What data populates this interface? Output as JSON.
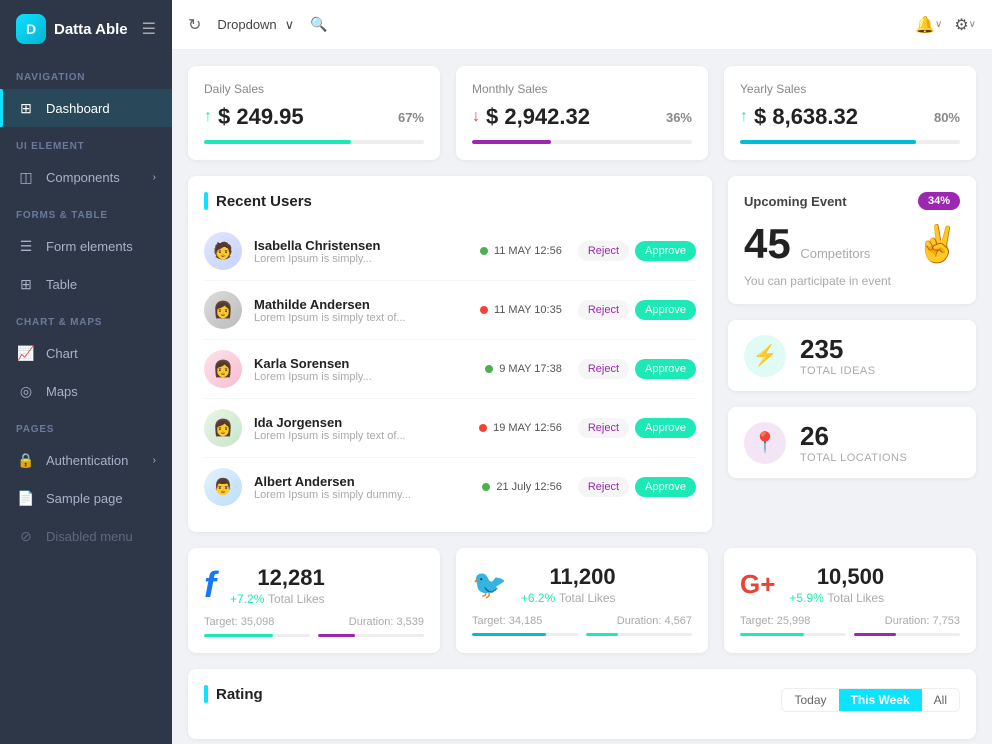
{
  "app": {
    "name": "Datta Able",
    "logo_letter": "D"
  },
  "header": {
    "dropdown_label": "Dropdown",
    "bell_label": "notifications",
    "gear_label": "settings"
  },
  "sidebar": {
    "nav_label": "NAVIGATION",
    "ui_label": "UI ELEMENT",
    "forms_label": "FORMS & TABLE",
    "charts_label": "CHART & MAPS",
    "pages_label": "PAGES",
    "items": [
      {
        "id": "dashboard",
        "label": "Dashboard",
        "icon": "⊞",
        "active": true
      },
      {
        "id": "components",
        "label": "Components",
        "icon": "◫",
        "has_chevron": true
      },
      {
        "id": "form-elements",
        "label": "Form elements",
        "icon": "☰"
      },
      {
        "id": "table",
        "label": "Table",
        "icon": "⊞"
      },
      {
        "id": "chart",
        "label": "Chart",
        "icon": "📈"
      },
      {
        "id": "maps",
        "label": "Maps",
        "icon": "◎"
      },
      {
        "id": "authentication",
        "label": "Authentication",
        "icon": "🔒",
        "has_chevron": true
      },
      {
        "id": "sample-page",
        "label": "Sample page",
        "icon": "📄"
      },
      {
        "id": "disabled-menu",
        "label": "Disabled menu",
        "icon": "⊘",
        "disabled": true
      }
    ]
  },
  "stats": [
    {
      "id": "daily-sales",
      "title": "Daily Sales",
      "value": "$ 249.95",
      "arrow": "up",
      "percent": "67%",
      "bar_width": "67",
      "bar_color": "green"
    },
    {
      "id": "monthly-sales",
      "title": "Monthly Sales",
      "value": "$ 2,942.32",
      "arrow": "down",
      "percent": "36%",
      "bar_width": "36",
      "bar_color": "purple"
    },
    {
      "id": "yearly-sales",
      "title": "Yearly Sales",
      "value": "$ 8,638.32",
      "arrow": "up",
      "percent": "80%",
      "bar_width": "80",
      "bar_color": "teal"
    }
  ],
  "recent_users": {
    "title": "Recent Users",
    "users": [
      {
        "name": "Isabella Christensen",
        "desc": "Lorem Ipsum is simply...",
        "date": "11 MAY 12:56",
        "dot": "green",
        "avatar": "🧑"
      },
      {
        "name": "Mathilde Andersen",
        "desc": "Lorem Ipsum is simply text of...",
        "date": "11 MAY 10:35",
        "dot": "red",
        "avatar": "👩"
      },
      {
        "name": "Karla Sorensen",
        "desc": "Lorem Ipsum is simply...",
        "date": "9 MAY 17:38",
        "dot": "green",
        "avatar": "👩"
      },
      {
        "name": "Ida Jorgensen",
        "desc": "Lorem Ipsum is simply text of...",
        "date": "19 MAY 12:56",
        "dot": "red",
        "avatar": "👩"
      },
      {
        "name": "Albert Andersen",
        "desc": "Lorem Ipsum is simply dummy...",
        "date": "21 July 12:56",
        "dot": "green",
        "avatar": "👨"
      }
    ],
    "btn_reject": "Reject",
    "btn_approve": "Approve"
  },
  "upcoming_event": {
    "title": "Upcoming Event",
    "badge": "34%",
    "number": "45",
    "label": "Competitors",
    "desc": "You can participate in event"
  },
  "total_ideas": {
    "number": "235",
    "label": "TOTAL IDEAS"
  },
  "total_locations": {
    "number": "26",
    "label": "TOTAL LOCATIONS"
  },
  "social": [
    {
      "id": "facebook",
      "icon": "f",
      "type": "fb",
      "likes": "12,281",
      "growth": "+7.2%",
      "label": "Total Likes",
      "target_label": "Target:",
      "target_val": "35,098",
      "duration_label": "Duration:",
      "duration_val": "3,539",
      "bar1": 65,
      "bar2": 35
    },
    {
      "id": "twitter",
      "icon": "🐦",
      "type": "tw",
      "likes": "11,200",
      "growth": "+6.2%",
      "label": "Total Likes",
      "target_label": "Target:",
      "target_val": "34,185",
      "duration_label": "Duration:",
      "duration_val": "4,567",
      "bar1": 70,
      "bar2": 30
    },
    {
      "id": "googleplus",
      "icon": "G+",
      "type": "gp",
      "likes": "10,500",
      "growth": "+5.9%",
      "label": "Total Likes",
      "target_label": "Target:",
      "target_val": "25,998",
      "duration_label": "Duration:",
      "duration_val": "7,753",
      "bar1": 60,
      "bar2": 40
    }
  ],
  "rating": {
    "title": "Rating",
    "tabs": [
      "Today",
      "This Week",
      "All"
    ],
    "active_tab": "This Week"
  }
}
